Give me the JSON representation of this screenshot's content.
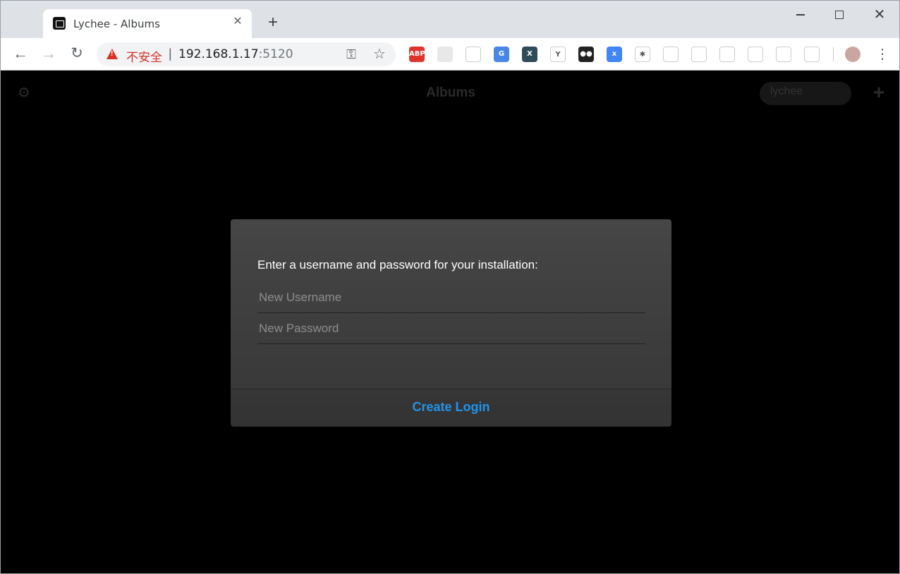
{
  "browser": {
    "tab_title": "Lychee - Albums",
    "address_insecure_label": "不安全",
    "address_host": "192.168.1.17",
    "address_port": ":5120",
    "extensions": [
      {
        "name": "adblock-plus-icon",
        "label": "ABP",
        "color": "#e0342b"
      },
      {
        "name": "translate-icon",
        "label": "",
        "color": "#e8e8e8"
      },
      {
        "name": "pocket-icon",
        "label": "",
        "color": "#ffffff"
      },
      {
        "name": "google-translate-icon",
        "label": "G",
        "color": "#4a86e8"
      },
      {
        "name": "x-extension-icon",
        "label": "X",
        "color": "#2e4b59"
      },
      {
        "name": "y-extension-icon",
        "label": "Y",
        "color": "#ffffff"
      },
      {
        "name": "tampermonkey-icon",
        "label": "●●",
        "color": "#222222"
      },
      {
        "name": "x-translate-icon",
        "label": "x",
        "color": "#4285f4"
      },
      {
        "name": "pinwheel-icon",
        "label": "✱",
        "color": "#ffffff"
      },
      {
        "name": "sitemap-icon",
        "label": "",
        "color": "#ffffff"
      },
      {
        "name": "location-icon",
        "label": "",
        "color": "#ffffff"
      },
      {
        "name": "octocat-icon",
        "label": "",
        "color": "#ffffff"
      },
      {
        "name": "github-icon",
        "label": "",
        "color": "#ffffff"
      },
      {
        "name": "green-gear-icon",
        "label": "",
        "color": "#ffffff"
      },
      {
        "name": "gitlab-icon",
        "label": "",
        "color": "#ffffff"
      }
    ]
  },
  "header": {
    "title": "Albums",
    "search_value": "lychee"
  },
  "dialog": {
    "prompt": "Enter a username and password for your installation:",
    "username_placeholder": "New Username",
    "password_placeholder": "New Password",
    "submit_label": "Create Login"
  },
  "colors": {
    "accent": "#2293ec",
    "insecure": "#d93025",
    "page_background": "#000000"
  }
}
